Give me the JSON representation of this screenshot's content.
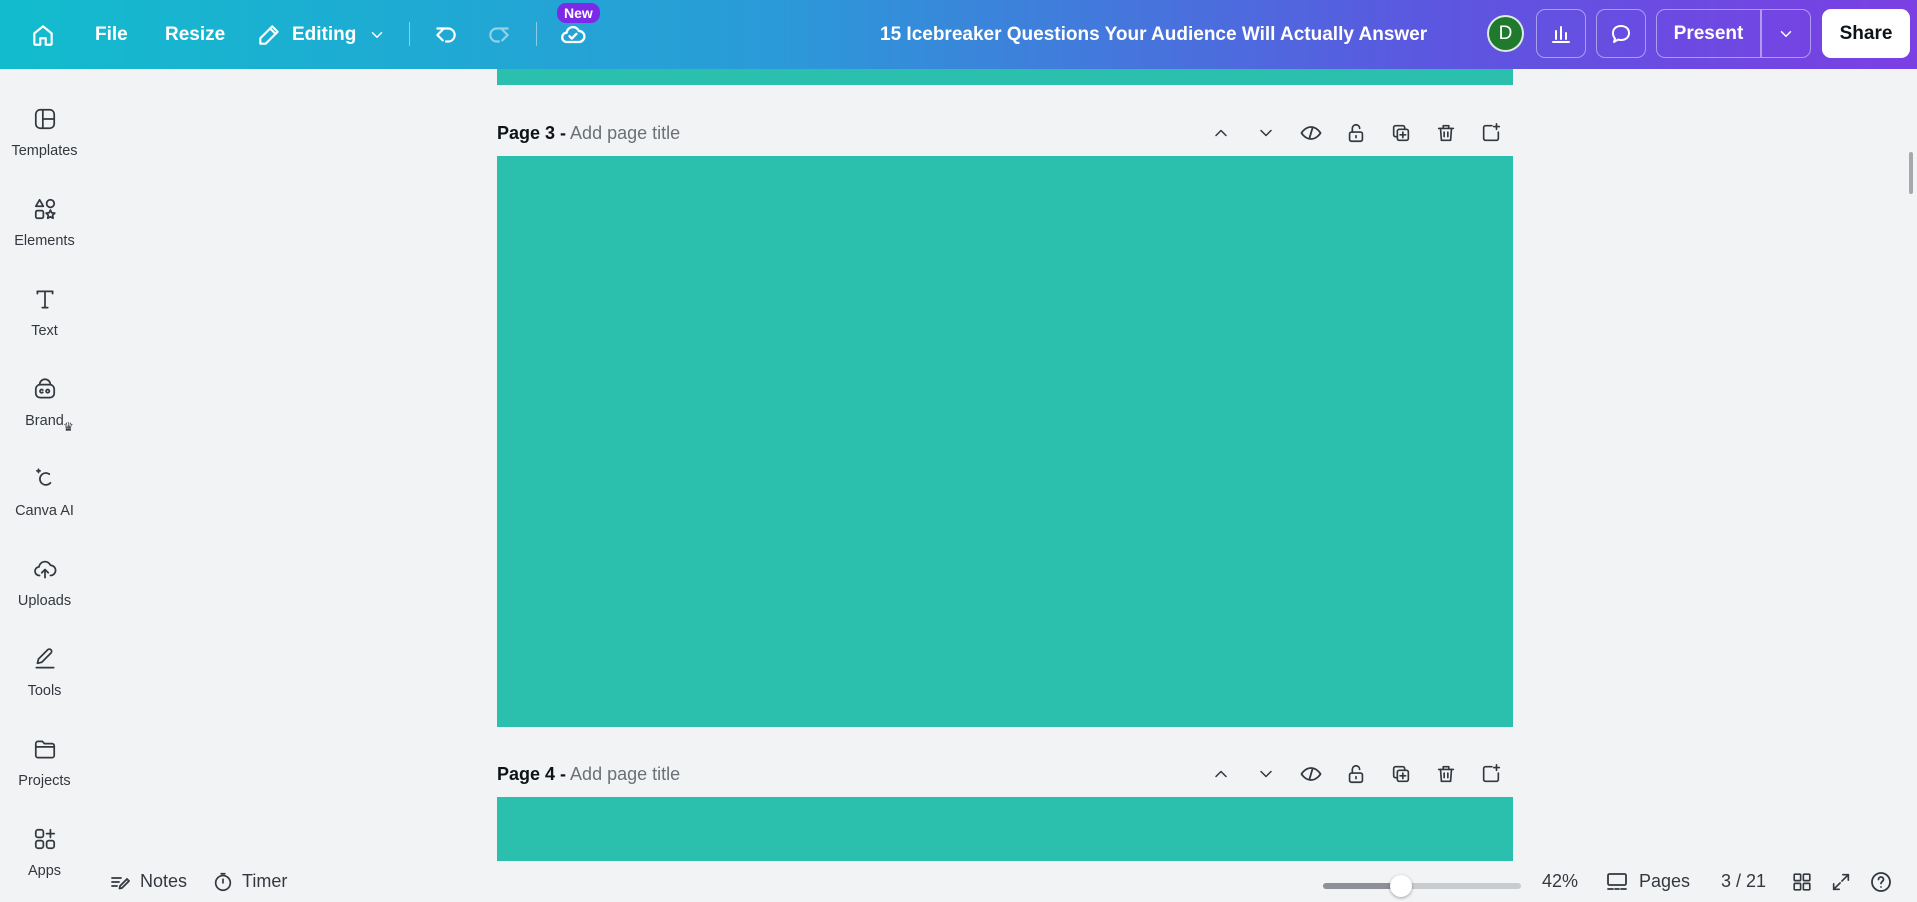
{
  "topbar": {
    "home_icon": "home-icon",
    "file_label": "File",
    "resize_label": "Resize",
    "editing_label": "Editing",
    "new_badge": "New",
    "document_title": "15 Icebreaker Questions Your Audience Will Actually Answer",
    "avatar_initial": "D",
    "present_label": "Present",
    "share_label": "Share"
  },
  "sidebar": {
    "items": [
      {
        "label": "Templates",
        "icon": "templates-icon"
      },
      {
        "label": "Elements",
        "icon": "elements-icon"
      },
      {
        "label": "Text",
        "icon": "text-icon"
      },
      {
        "label": "Brand",
        "icon": "brand-icon"
      },
      {
        "label": "Canva AI",
        "icon": "canva-ai-icon"
      },
      {
        "label": "Uploads",
        "icon": "uploads-icon"
      },
      {
        "label": "Tools",
        "icon": "tools-icon"
      },
      {
        "label": "Projects",
        "icon": "projects-icon"
      },
      {
        "label": "Apps",
        "icon": "apps-icon"
      }
    ]
  },
  "pages": [
    {
      "label": "Page 3 -",
      "title_placeholder": "Add page title",
      "color": "#2bbfae"
    },
    {
      "label": "Page 4 -",
      "title_placeholder": "Add page title",
      "color": "#2bbfae"
    }
  ],
  "bottombar": {
    "notes_label": "Notes",
    "timer_label": "Timer",
    "zoom_percent": "42%",
    "zoom_fraction": 0.38,
    "pages_label": "Pages",
    "page_count": "3 / 21"
  },
  "colors": {
    "page_fill": "#2bbfae",
    "brand_gradient_start": "#12bccd",
    "brand_gradient_end": "#7b3fe4",
    "avatar": "#1f7a2e"
  }
}
